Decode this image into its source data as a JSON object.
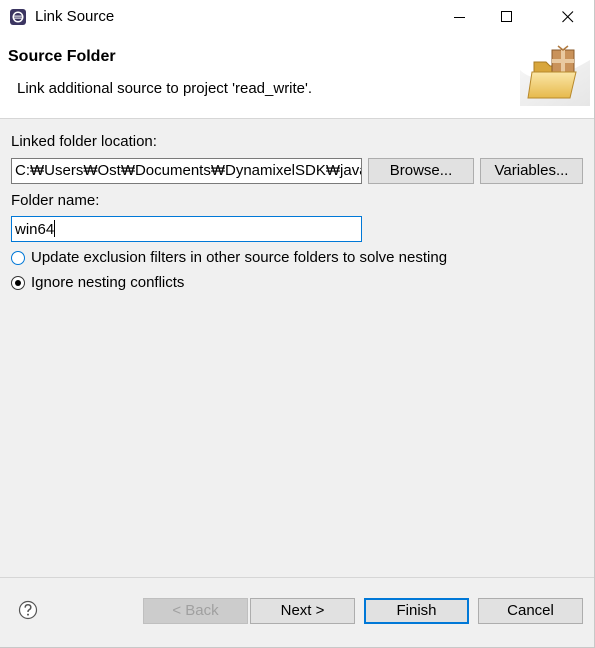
{
  "window": {
    "title": "Link Source",
    "controls": {
      "minimize": "minimize",
      "maximize": "maximize",
      "close": "close"
    }
  },
  "banner": {
    "title": "Source Folder",
    "description": "Link additional source to project 'read_write'.",
    "image_icon": "folder-with-package-icon"
  },
  "form": {
    "location_label": "Linked folder location:",
    "location_value": "C:₩Users₩Ost₩Documents₩DynamixelSDK₩java₩c",
    "browse_label": "Browse...",
    "variables_label": "Variables...",
    "name_label": "Folder name:",
    "name_value": "win64",
    "options": [
      {
        "label": "Update exclusion filters in other source folders to solve nesting",
        "selected": false
      },
      {
        "label": "Ignore nesting conflicts",
        "selected": true
      }
    ]
  },
  "footer": {
    "help_icon": "help-icon",
    "back_label": "< Back",
    "next_label": "Next >",
    "finish_label": "Finish",
    "cancel_label": "Cancel"
  },
  "colors": {
    "accent": "#0078d7",
    "dialog_bg": "#f0f0f0",
    "button_bg": "#e1e1e1"
  }
}
